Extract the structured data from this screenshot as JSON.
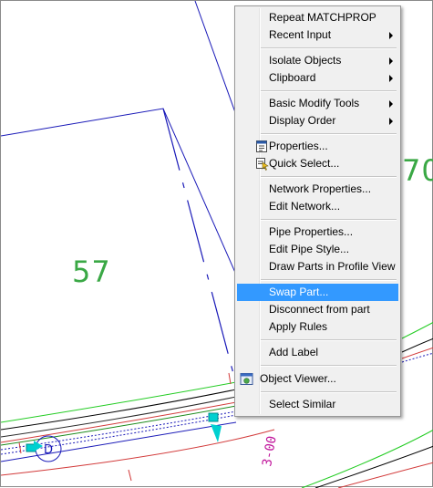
{
  "drawing": {
    "parcel_labels": [
      "57",
      "70"
    ],
    "pipe_station_label": "3-00",
    "structure_label": "D"
  },
  "menu": {
    "items": [
      {
        "label": "Repeat MATCHPROP"
      },
      {
        "label": "Recent Input"
      },
      {
        "label": "Isolate Objects"
      },
      {
        "label": "Clipboard"
      },
      {
        "label": "Basic Modify Tools"
      },
      {
        "label": "Display Order"
      },
      {
        "label": "Properties..."
      },
      {
        "label": "Quick Select..."
      },
      {
        "label": "Network Properties..."
      },
      {
        "label": "Edit Network..."
      },
      {
        "label": "Pipe Properties..."
      },
      {
        "label": "Edit Pipe Style..."
      },
      {
        "label": "Draw Parts in Profile View"
      },
      {
        "label": "Swap Part..."
      },
      {
        "label": "Disconnect from part"
      },
      {
        "label": "Apply Rules"
      },
      {
        "label": "Add Label"
      },
      {
        "label": "Object Viewer..."
      },
      {
        "label": "Select Similar"
      }
    ],
    "highlighted": "Swap Part...",
    "submenu_items": [
      "Recent Input",
      "Isolate Objects",
      "Clipboard",
      "Basic Modify Tools",
      "Display Order"
    ],
    "icons": {
      "Properties...": "properties-icon",
      "Quick Select...": "quick-select-icon",
      "Object Viewer...": "object-viewer-icon"
    }
  },
  "colors": {
    "parcel_line": "#1a1ab8",
    "parcel_label": "#3aa845",
    "highlight": "#3399ff",
    "pipe_label": "#c0149b",
    "structure": "#00d0d0"
  }
}
